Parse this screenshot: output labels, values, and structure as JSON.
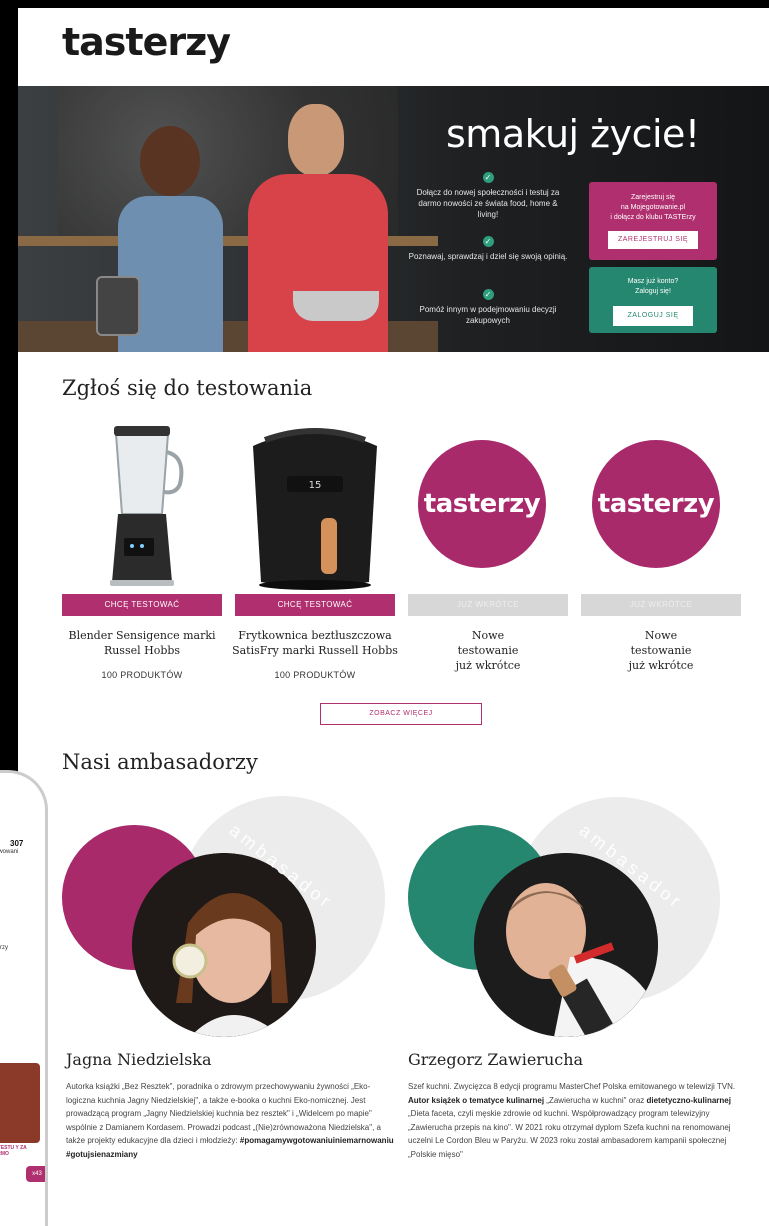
{
  "brand": {
    "logo": "tasterzy",
    "accent": "#b0306f",
    "green": "#25876f"
  },
  "hero": {
    "slogan": "smakuj życie!",
    "features": [
      {
        "text": "Dołącz do nowej społeczności i testuj za darmo nowości ze świata food, home & living!"
      },
      {
        "text": "Poznawaj, sprawdzaj i dziel się swoją opinią."
      },
      {
        "text": "Pomóż innym w podejmowaniu decyzji zakupowych"
      }
    ],
    "register_card": {
      "line1": "Zarejestruj się",
      "line2": "na Mojegotowanie.pl",
      "line3": "i dołącz do klubu TASTErzy",
      "button": "ZAREJESTRUJ SIĘ"
    },
    "login_card": {
      "line1": "Masz już konto?",
      "line2": "Zaloguj się!",
      "button": "ZALOGUJ SIĘ"
    }
  },
  "testing": {
    "heading": "Zgłoś się do testowania",
    "products": [
      {
        "button": "CHCĘ TESTOWAĆ",
        "name": "Blender Sensigence marki Russel Hobbs",
        "count": "100 PRODUKTÓW"
      },
      {
        "button": "CHCĘ TESTOWAĆ",
        "name": "Frytkownica beztłuszczowa SatisFry marki Russell Hobbs",
        "count": "100 PRODUKTÓW"
      },
      {
        "button": "JUŻ WKRÓTCE",
        "name": "Nowe testowanie już wkrótce",
        "logo": "tasterzy"
      },
      {
        "button": "JUŻ WKRÓTCE",
        "name": "Nowe testowanie już wkrótce",
        "logo": "tasterzy"
      }
    ],
    "more_button": "ZOBACZ WIĘCEJ"
  },
  "ambassadors": {
    "heading": "Nasi ambasadorzy",
    "badge_word": "ambasador",
    "people": [
      {
        "name": "Jagna Niedzielska",
        "bio": "Autorka książki „Bez Resztek\", poradnika o zdrowym przechowywaniu żywności „Eko-logiczna kuchnia Jagny Niedzielskiej\", a także e-booka o kuchni Eko-nomicznej. Jest prowadzącą program „Jagny Niedzielskiej kuchnia bez resztek\" i „Widelcem po mapie\" wspólnie z Damianem Kordasem. Prowadzi podcast „(Nie)zrównoważona Niedzielska\", a także projekty edukacyjne dla dzieci i młodzieży:",
        "tags": "#pomagamywgotowaniuiniemarnowaniu #gotujsienazmiany",
        "color": "#a82a6a"
      },
      {
        "name": "Grzegorz Zawierucha",
        "bio_a": "Szef kuchni. Zwycięzca 8 edycji programu MasterChef Polska emitowanego w telewizji TVN. ",
        "bio_b": "Autor książek o tematyce kulinarnej",
        "bio_c": " „Zawierucha w kuchni\" oraz ",
        "bio_d": "dietetyczno-kulinarnej",
        "bio_e": " „Dieta faceta, czyli męskie zdrowie od kuchni. Współprowadzący program telewizyjny „Zawierucha przepis na kino\". W 2021 roku otrzymał dyplom Szefa kuchni na renomowanej uczelni Le Cordon Bleu w Paryżu. W 2023 roku został ambasadorem kampanii społecznej „Polskie mięso\"",
        "color": "#25876f"
      }
    ]
  },
  "phone": {
    "count": "307",
    "label": "serwowani",
    "snippet": "rzy",
    "badge": "x43",
    "mini_text": "ĘŻ TESTU Y ZA DARMO"
  }
}
